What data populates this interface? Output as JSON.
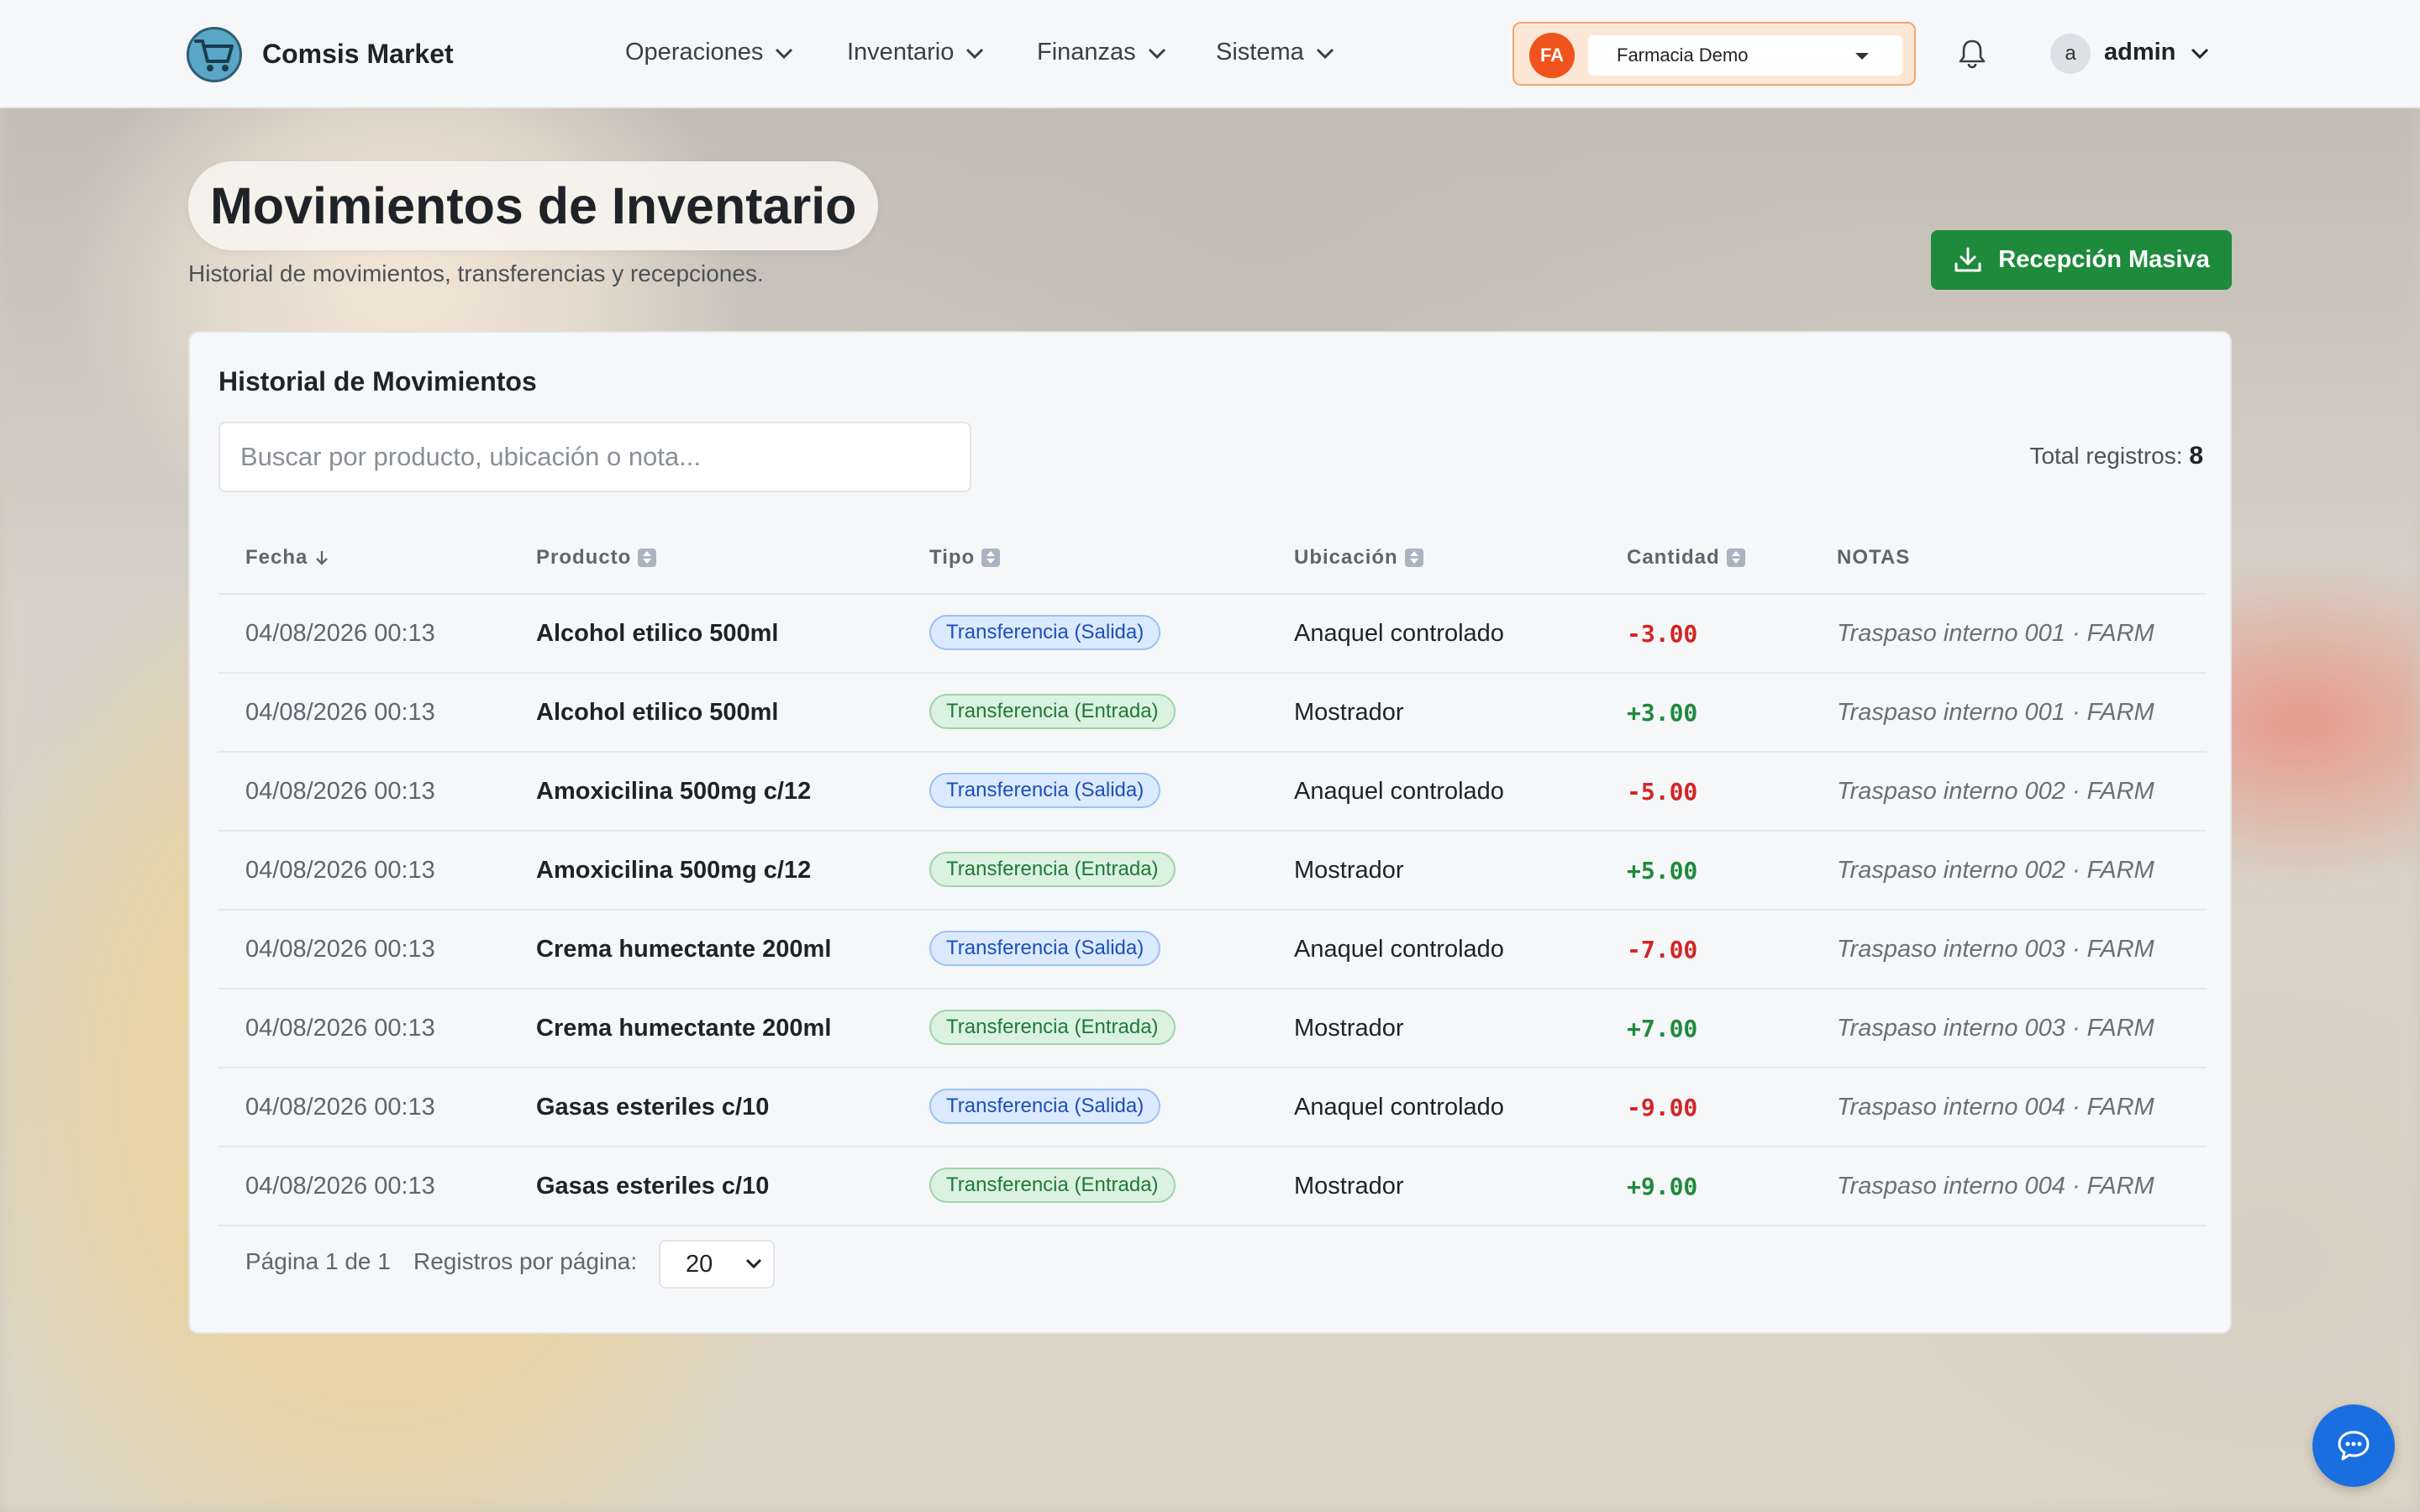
{
  "brand": {
    "name": "Comsis Market"
  },
  "nav": [
    {
      "label": "Operaciones"
    },
    {
      "label": "Inventario"
    },
    {
      "label": "Finanzas"
    },
    {
      "label": "Sistema"
    }
  ],
  "store": {
    "initials": "FA",
    "selected": "Farmacia Demo"
  },
  "user": {
    "initial": "a",
    "name": "admin"
  },
  "page": {
    "title": "Movimientos de Inventario",
    "subtitle": "Historial de movimientos, transferencias y recepciones.",
    "mass_button": "Recepción Masiva"
  },
  "card": {
    "title": "Historial de Movimientos",
    "search_placeholder": "Buscar por producto, ubicación o nota...",
    "total_label": "Total registros:",
    "total_value": "8",
    "columns": {
      "fecha": "Fecha",
      "producto": "Producto",
      "tipo": "Tipo",
      "ubicacion": "Ubicación",
      "cantidad": "Cantidad",
      "notas": "NOTAS"
    },
    "rows": [
      {
        "date": "04/08/2026 00:13",
        "product": "Alcohol etilico 500ml",
        "type": "Transferencia (Salida)",
        "dir": "out",
        "location": "Anaquel controlado",
        "qty": "-3.00",
        "note": "Traspaso interno 001 · FARM"
      },
      {
        "date": "04/08/2026 00:13",
        "product": "Alcohol etilico 500ml",
        "type": "Transferencia (Entrada)",
        "dir": "in",
        "location": "Mostrador",
        "qty": "+3.00",
        "note": "Traspaso interno 001 · FARM"
      },
      {
        "date": "04/08/2026 00:13",
        "product": "Amoxicilina 500mg c/12",
        "type": "Transferencia (Salida)",
        "dir": "out",
        "location": "Anaquel controlado",
        "qty": "-5.00",
        "note": "Traspaso interno 002 · FARM"
      },
      {
        "date": "04/08/2026 00:13",
        "product": "Amoxicilina 500mg c/12",
        "type": "Transferencia (Entrada)",
        "dir": "in",
        "location": "Mostrador",
        "qty": "+5.00",
        "note": "Traspaso interno 002 · FARM"
      },
      {
        "date": "04/08/2026 00:13",
        "product": "Crema humectante 200ml",
        "type": "Transferencia (Salida)",
        "dir": "out",
        "location": "Anaquel controlado",
        "qty": "-7.00",
        "note": "Traspaso interno 003 · FARM"
      },
      {
        "date": "04/08/2026 00:13",
        "product": "Crema humectante 200ml",
        "type": "Transferencia (Entrada)",
        "dir": "in",
        "location": "Mostrador",
        "qty": "+7.00",
        "note": "Traspaso interno 003 · FARM"
      },
      {
        "date": "04/08/2026 00:13",
        "product": "Gasas esteriles c/10",
        "type": "Transferencia (Salida)",
        "dir": "out",
        "location": "Anaquel controlado",
        "qty": "-9.00",
        "note": "Traspaso interno 004 · FARM"
      },
      {
        "date": "04/08/2026 00:13",
        "product": "Gasas esteriles c/10",
        "type": "Transferencia (Entrada)",
        "dir": "in",
        "location": "Mostrador",
        "qty": "+9.00",
        "note": "Traspaso interno 004 · FARM"
      }
    ],
    "pager": {
      "page_text": "Página 1 de 1",
      "per_page_label": "Registros por página:",
      "per_page_value": "20"
    }
  },
  "colors": {
    "accent_green": "#1e8a3c",
    "negative_red": "#d42424",
    "store_orange": "#f0531c",
    "chat_blue": "#1a6fe0"
  },
  "icons": {
    "logo": "shopping-cart-icon",
    "bell": "bell-icon",
    "download": "download-icon",
    "chat": "chat-bubble-icon"
  }
}
